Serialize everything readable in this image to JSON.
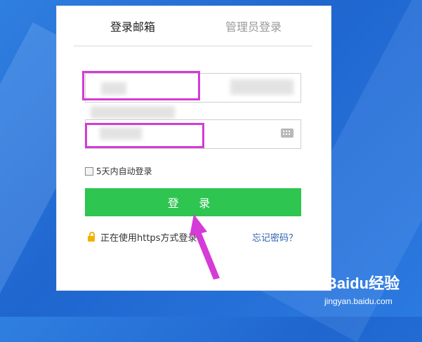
{
  "tabs": {
    "email_login": "登录邮箱",
    "admin_login": "管理员登录"
  },
  "form": {
    "username_value": "",
    "password_value": "",
    "remember_label": "5天内自动登录",
    "login_button": "登 录",
    "https_note": "正在使用https方式登录",
    "forgot_password": "忘记密码？"
  },
  "icons": {
    "keyboard": "keyboard-icon",
    "lock": "lock-icon",
    "checkbox": "checkbox"
  },
  "colors": {
    "background": "#2f7fe0",
    "login_button": "#2ec551",
    "highlight": "#d43bd7",
    "link": "#2a62b0"
  },
  "watermark": {
    "brand": "Baidu经验",
    "url": "jingyan.baidu.com"
  }
}
